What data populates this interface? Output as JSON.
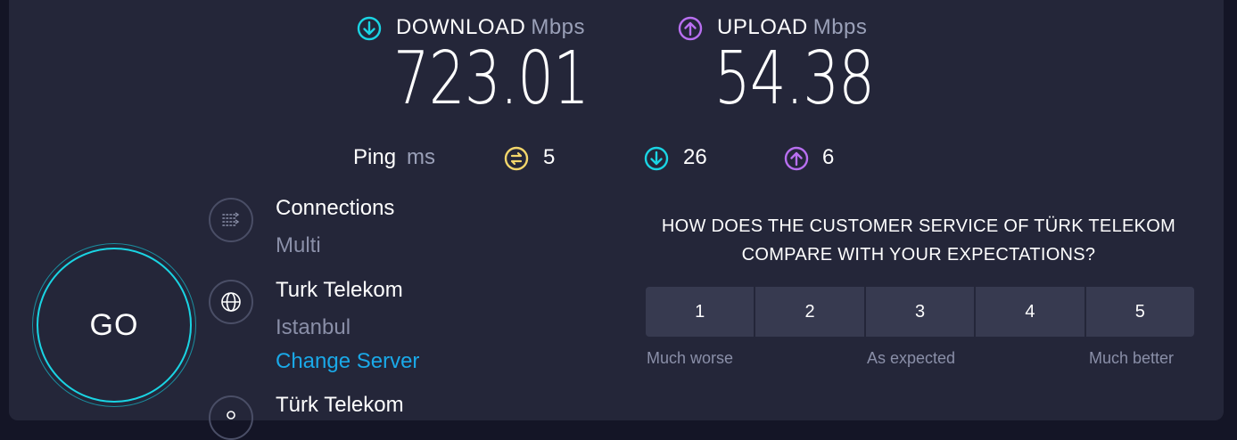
{
  "download": {
    "label": "DOWNLOAD",
    "unit": "Mbps",
    "value": "723.01",
    "icon": "arrow-down-circle-icon",
    "color": "#1ad4e3"
  },
  "upload": {
    "label": "UPLOAD",
    "unit": "Mbps",
    "value": "54.38",
    "icon": "arrow-up-circle-icon",
    "color": "#b86ff0"
  },
  "ping": {
    "label": "Ping",
    "unit": "ms",
    "idle": "5",
    "download": "26",
    "upload": "6",
    "idle_color": "#f3d66b"
  },
  "go_label": "GO",
  "connections": {
    "title": "Connections",
    "value": "Multi"
  },
  "server": {
    "title": "Turk Telekom",
    "location": "Istanbul",
    "change_label": "Change Server"
  },
  "provider": {
    "title": "Türk Telekom"
  },
  "survey": {
    "question": "HOW DOES THE CUSTOMER SERVICE OF TÜRK TELEKOM COMPARE WITH YOUR EXPECTATIONS?",
    "options": [
      "1",
      "2",
      "3",
      "4",
      "5"
    ],
    "low_label": "Much worse",
    "mid_label": "As expected",
    "high_label": "Much better"
  }
}
